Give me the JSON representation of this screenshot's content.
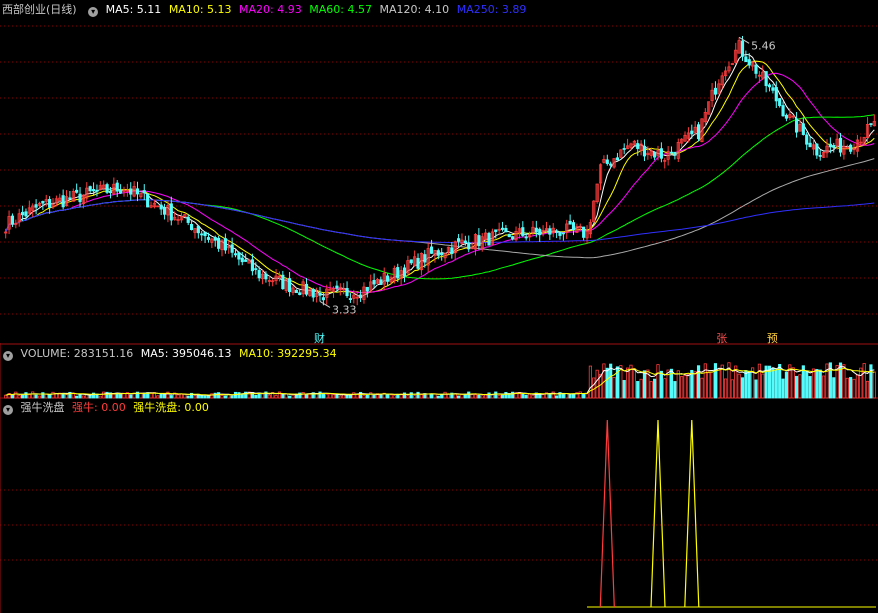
{
  "colors": {
    "up": "#ff3c3c",
    "down": "#54fcfc",
    "ma5": "#ffffff",
    "ma10": "#ffff00",
    "ma20": "#ff00ff",
    "ma60": "#00ff00",
    "ma120": "#aaaaaa",
    "ma250": "#3030ff",
    "grid": "#8b0000",
    "label": "#c8c8c8"
  },
  "main": {
    "title": "西部创业(日线)",
    "ma_labels": [
      {
        "key": "ma5",
        "text": "MA5: 5.11"
      },
      {
        "key": "ma10",
        "text": "MA10: 5.13"
      },
      {
        "key": "ma20",
        "text": "MA20: 4.93"
      },
      {
        "key": "ma60",
        "text": "MA60: 4.57"
      },
      {
        "key": "ma120",
        "text": "MA120: 4.10"
      },
      {
        "key": "ma250",
        "text": "MA250: 3.89"
      }
    ],
    "high_label": "5.46",
    "low_label": "3.33",
    "markers": [
      {
        "text": "财",
        "index": 93
      },
      {
        "text": "张",
        "index": 212
      },
      {
        "text": "预",
        "index": 227
      }
    ]
  },
  "volume_panel": {
    "label": "VOLUME: 283151.16",
    "ma5": "MA5: 395046.13",
    "ma10": "MA10: 392295.34"
  },
  "indicator_panel": {
    "title": "强牛洗盘",
    "s1": "强牛: 0.00",
    "s2": "强牛洗盘: 0.00"
  },
  "chart_data": {
    "type": "candlestick",
    "ylim": [
      3.1,
      5.6
    ],
    "anchors": [
      [
        0,
        3.95
      ],
      [
        10,
        4.1
      ],
      [
        25,
        4.2
      ],
      [
        35,
        4.25
      ],
      [
        45,
        4.1
      ],
      [
        55,
        3.95
      ],
      [
        65,
        3.75
      ],
      [
        75,
        3.55
      ],
      [
        85,
        3.45
      ],
      [
        95,
        3.38
      ],
      [
        105,
        3.42
      ],
      [
        115,
        3.55
      ],
      [
        125,
        3.7
      ],
      [
        135,
        3.8
      ],
      [
        145,
        3.85
      ],
      [
        155,
        3.88
      ],
      [
        165,
        3.9
      ],
      [
        172,
        3.88
      ],
      [
        176,
        4.4
      ],
      [
        185,
        4.6
      ],
      [
        195,
        4.5
      ],
      [
        205,
        4.7
      ],
      [
        212,
        5.2
      ],
      [
        217,
        5.38
      ],
      [
        222,
        5.2
      ],
      [
        232,
        4.8
      ],
      [
        240,
        4.55
      ],
      [
        250,
        4.6
      ],
      [
        257,
        4.75
      ]
    ],
    "count": 258,
    "high": {
      "index": 217,
      "value": 5.46
    },
    "low": {
      "index": 93,
      "value": 3.33
    },
    "indicator_peaks": [
      {
        "index": 178,
        "series": "强牛"
      },
      {
        "index": 193,
        "series": "强牛洗盘"
      },
      {
        "index": 203,
        "series": "强牛洗盘"
      }
    ]
  }
}
